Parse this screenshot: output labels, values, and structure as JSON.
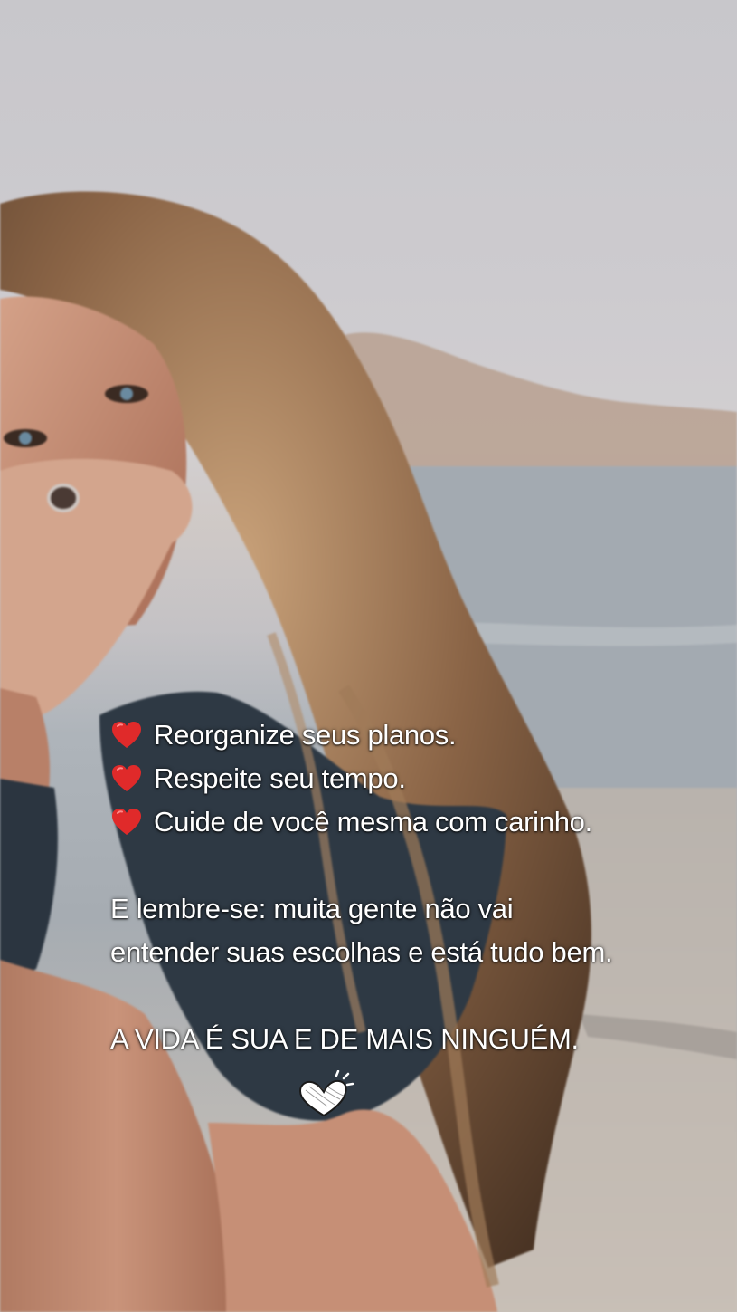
{
  "caption": {
    "bullets": [
      "Reorganize seus planos.",
      "Respeite seu tempo.",
      "Cuide de você mesma com carinho."
    ],
    "reminder_line1": "E lembre-se: muita gente não vai",
    "reminder_line2": "entender suas escolhas e está tudo bem.",
    "closing": "A VIDA É SUA E DE MAIS NINGUÉM."
  },
  "icons": {
    "bullet": "red-heart-icon",
    "doodle": "sketched-heart-icon"
  },
  "colors": {
    "text": "#ffffff",
    "heart": "#e02a2a",
    "sky": "#c8c7cb",
    "sea": "#a6acb2"
  }
}
